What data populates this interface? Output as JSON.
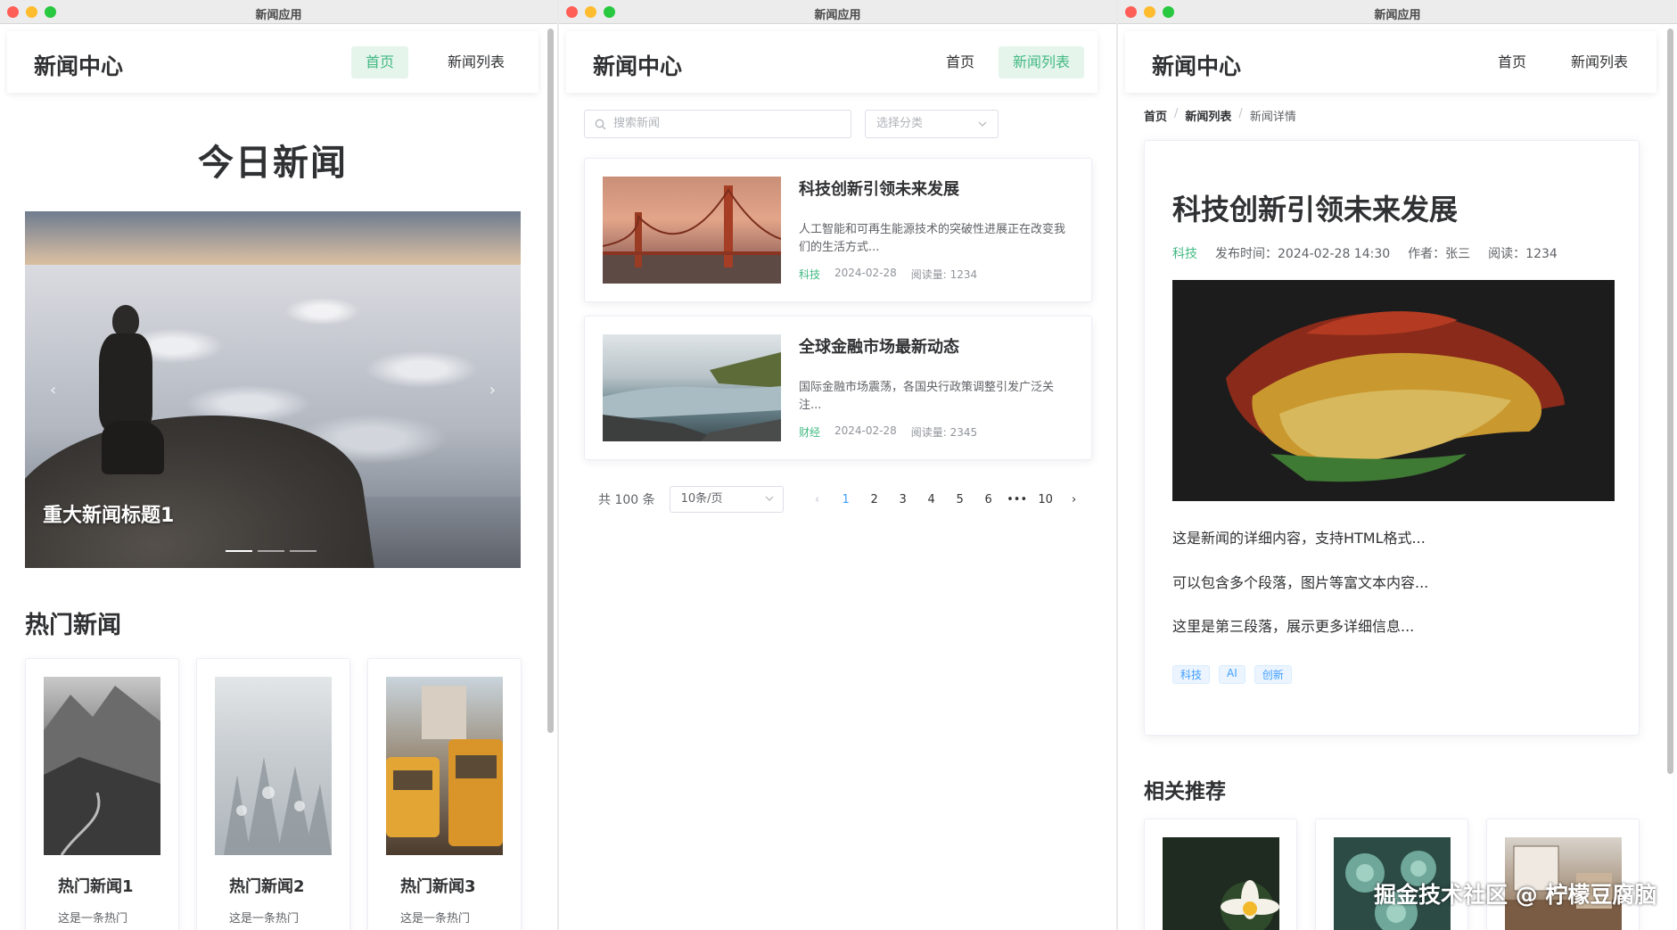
{
  "window_title": "新闻应用",
  "brand": "新闻中心",
  "nav": {
    "home": "首页",
    "list": "新闻列表"
  },
  "home": {
    "heading": "今日新闻",
    "carousel_caption": "重大新闻标题1",
    "hot_heading": "热门新闻",
    "hot": [
      {
        "title": "热门新闻1",
        "desc": "这是一条热门"
      },
      {
        "title": "热门新闻2",
        "desc": "这是一条热门"
      },
      {
        "title": "热门新闻3",
        "desc": "这是一条热门"
      }
    ]
  },
  "list": {
    "search_placeholder": "搜索新闻",
    "category_placeholder": "选择分类",
    "items": [
      {
        "title": "科技创新引领未来发展",
        "summary": "人工智能和可再生能源技术的突破性进展正在改变我们的生活方式...",
        "category": "科技",
        "date": "2024-02-28",
        "reads": "阅读量: 1234"
      },
      {
        "title": "全球金融市场最新动态",
        "summary": "国际金融市场震荡，各国央行政策调整引发广泛关注...",
        "category": "财经",
        "date": "2024-02-28",
        "reads": "阅读量: 2345"
      }
    ],
    "total": "共 100 条",
    "page_size": "10条/页",
    "pages": [
      "1",
      "2",
      "3",
      "4",
      "5",
      "6",
      "•••",
      "10"
    ],
    "current_page": "1"
  },
  "detail": {
    "breadcrumb": {
      "home": "首页",
      "list": "新闻列表",
      "current": "新闻详情",
      "sep": "/"
    },
    "title": "科技创新引领未来发展",
    "category": "科技",
    "publish_time": "发布时间：2024-02-28 14:30",
    "author": "作者：张三",
    "reads": "阅读：1234",
    "paragraphs": [
      "这是新闻的详细内容，支持HTML格式...",
      "可以包含多个段落，图片等富文本内容...",
      "这里是第三段落，展示更多详细信息..."
    ],
    "tags": [
      "科技",
      "AI",
      "创新"
    ],
    "related_heading": "相关推荐"
  },
  "watermark": "掘金技术社区 @ 柠檬豆腐脑",
  "colors": {
    "accent": "#42b983",
    "accent_bg": "#e6f5ec",
    "link": "#409eff"
  }
}
